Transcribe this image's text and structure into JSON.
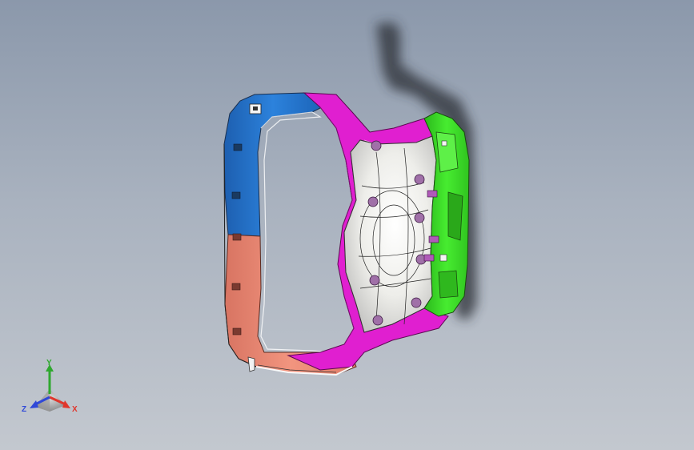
{
  "triad": {
    "x_label": "X",
    "y_label": "Y",
    "z_label": "Z",
    "x_color": "#e0362c",
    "y_color": "#2fa82f",
    "z_color": "#2f48d8"
  },
  "part": {
    "colors": {
      "blue_face": "#2c7fd6",
      "salmon_face": "#f08c78",
      "magenta_face": "#e01fd0",
      "green_face": "#3fe02a",
      "white_face": "#f4f4f0",
      "shadow": "#2a2e35"
    }
  }
}
